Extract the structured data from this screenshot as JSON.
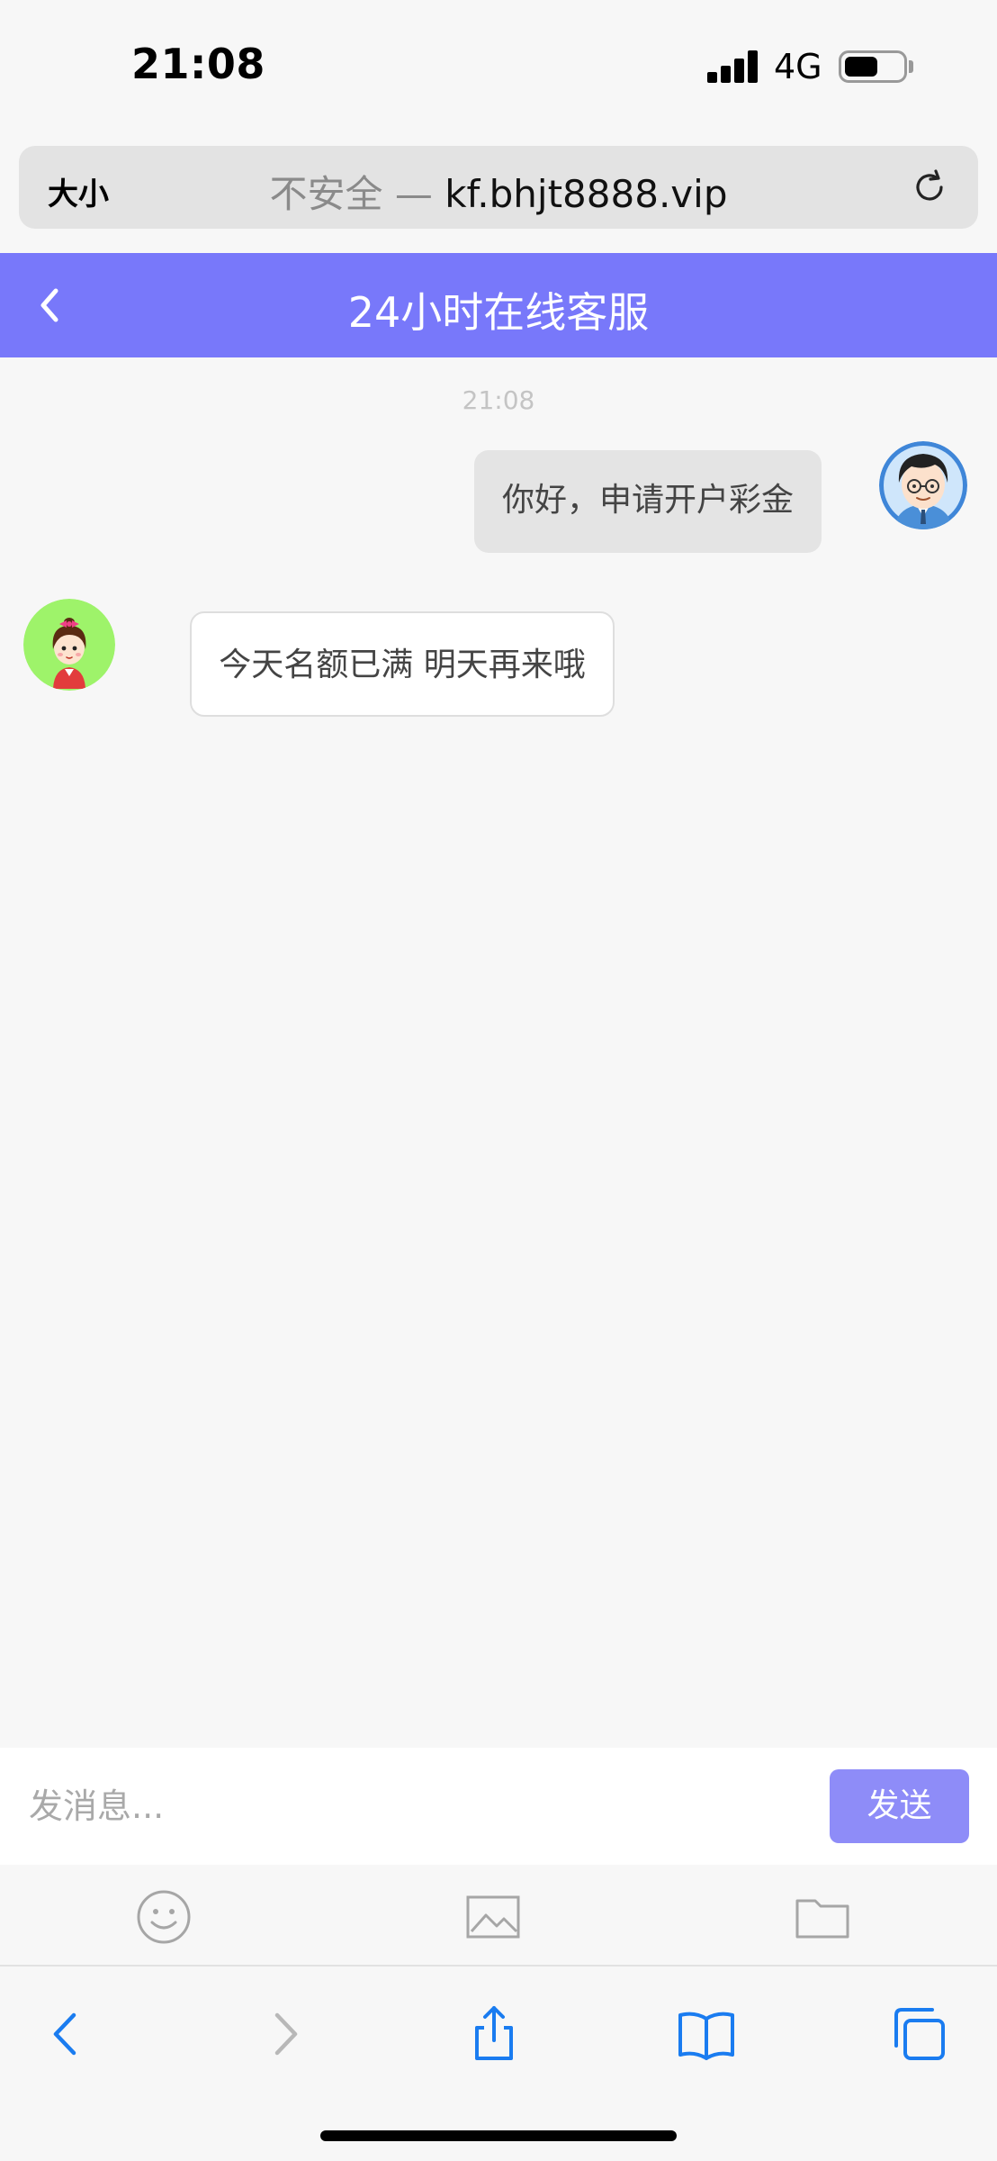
{
  "status_bar": {
    "time": "21:08",
    "network": "4G"
  },
  "url_bar": {
    "text_size_label": "大小",
    "insecure_label": "不安全",
    "separator": " — ",
    "domain": "kf.bhjt8888.vip"
  },
  "header": {
    "title": "24小时在线客服"
  },
  "chat": {
    "timestamp": "21:08",
    "messages": [
      {
        "sender": "me",
        "text": "你好，申请开户彩金"
      },
      {
        "sender": "agent",
        "text": "今天名额已满 明天再来哦"
      }
    ]
  },
  "composer": {
    "placeholder": "发消息...",
    "value": "",
    "send_label": "发送"
  },
  "tools": [
    "emoji-icon",
    "image-icon",
    "folder-icon"
  ],
  "safari_toolbar": [
    "back-icon",
    "forward-icon",
    "share-icon",
    "bookmarks-icon",
    "tabs-icon"
  ],
  "colors": {
    "accent": "#7878fa",
    "send_button": "#8e8cf8",
    "ios_blue": "#1a7cf0"
  }
}
